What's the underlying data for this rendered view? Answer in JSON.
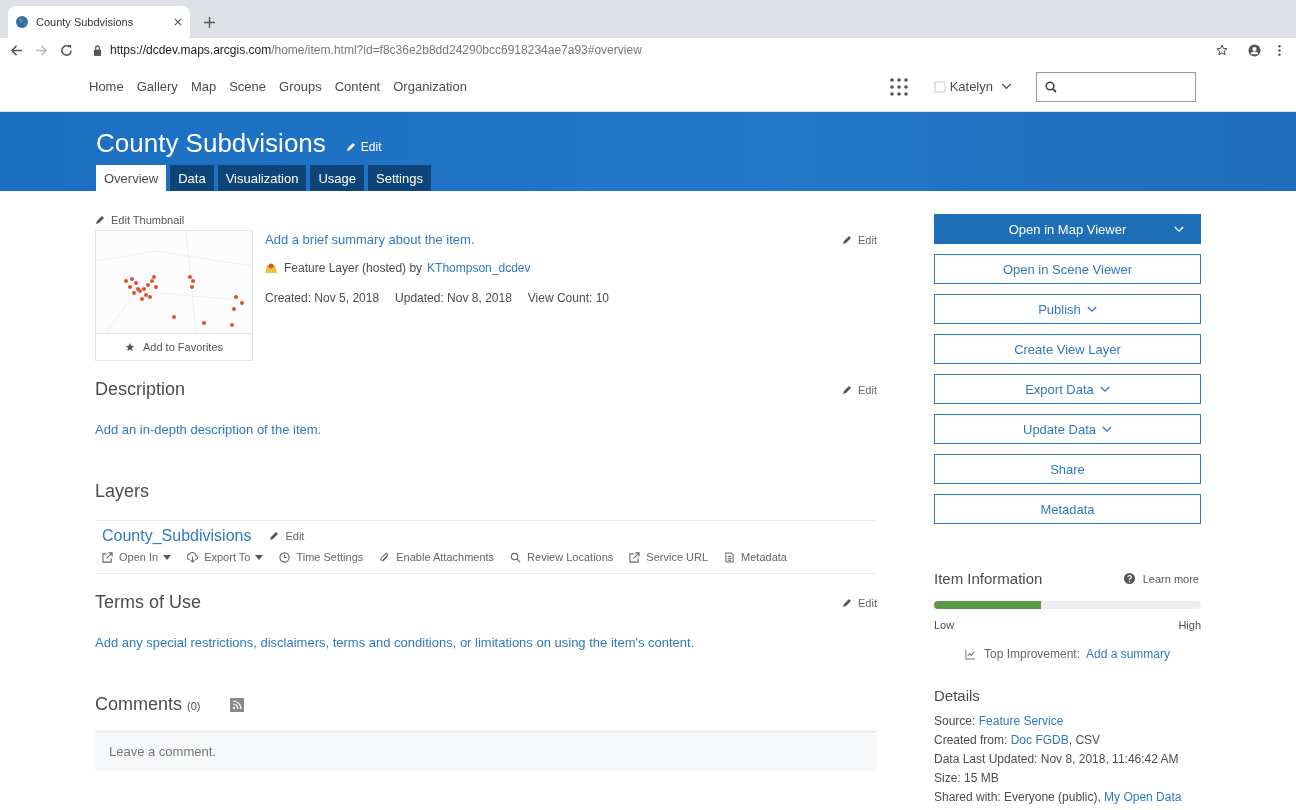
{
  "browser": {
    "tab_title": "County Subdvisions",
    "url_host": "https://dcdev.maps.arcgis.com",
    "url_path": "/home/item.html?id=f8c36e2b8dd24290bcc6918234ae7a93#overview"
  },
  "nav": {
    "items": [
      "Home",
      "Gallery",
      "Map",
      "Scene",
      "Groups",
      "Content",
      "Organization"
    ],
    "user": "Katelyn"
  },
  "header": {
    "title": "County Subdvisions",
    "edit": "Edit"
  },
  "tabs": [
    {
      "label": "Overview",
      "selected": true
    },
    {
      "label": "Data",
      "selected": false
    },
    {
      "label": "Visualization",
      "selected": false
    },
    {
      "label": "Usage",
      "selected": false
    },
    {
      "label": "Settings",
      "selected": false
    }
  ],
  "summary": {
    "edit_thumbnail": "Edit Thumbnail",
    "add_favorites": "Add to Favorites",
    "summary_link": "Add a brief summary about the item.",
    "edit": "Edit",
    "type_text": "Feature Layer (hosted) by",
    "owner": "KThompson_dcdev",
    "created": "Created: Nov 5, 2018",
    "updated": "Updated: Nov 8, 2018",
    "views": "View Count: 10"
  },
  "description": {
    "title": "Description",
    "edit": "Edit",
    "link": "Add an in-depth description of the item."
  },
  "layers": {
    "title": "Layers",
    "layer": {
      "name": "County_Subdivisions",
      "edit": "Edit",
      "actions": [
        {
          "label": "Open In",
          "caret": true
        },
        {
          "label": "Export To",
          "caret": true
        },
        {
          "label": "Time Settings",
          "caret": false
        },
        {
          "label": "Enable Attachments",
          "caret": false
        },
        {
          "label": "Review Locations",
          "caret": false
        },
        {
          "label": "Service URL",
          "caret": false
        },
        {
          "label": "Metadata",
          "caret": false
        }
      ]
    }
  },
  "terms": {
    "title": "Terms of Use",
    "edit": "Edit",
    "link": "Add any special restrictions, disclaimers, terms and conditions, or limitations on using the item's content."
  },
  "comments": {
    "title": "Comments",
    "count": "(0)",
    "field": {
      "placeholder": "Leave a comment."
    }
  },
  "actions": [
    {
      "label": "Open in Map Viewer",
      "kind": "primary",
      "caret": true
    },
    {
      "label": "Open in Scene Viewer",
      "kind": "outline",
      "caret": false
    },
    {
      "label": "Publish",
      "kind": "outline",
      "caret": true
    },
    {
      "label": "Create View Layer",
      "kind": "outline",
      "caret": false
    },
    {
      "label": "Export Data",
      "kind": "outline",
      "caret": true
    },
    {
      "label": "Update Data",
      "kind": "outline",
      "caret": true
    },
    {
      "label": "Share",
      "kind": "outline",
      "caret": false
    },
    {
      "label": "Metadata",
      "kind": "outline",
      "caret": false
    }
  ],
  "item_information": {
    "title": "Item Information",
    "learn_more": "Learn more",
    "level": 0.4,
    "low": "Low",
    "high": "High",
    "improvement_label": "Top Improvement:",
    "improvement_link": "Add a summary"
  },
  "details": {
    "title": "Details",
    "rows": [
      [
        {
          "text": "Source:",
          "link": false
        },
        {
          "text": "Feature Service",
          "link": true
        }
      ],
      [
        {
          "text": "Created from:",
          "link": false
        },
        {
          "text": "Doc FGDB",
          "link": true
        },
        {
          "text": ", CSV",
          "link": false
        }
      ],
      [
        {
          "text": "Data Last Updated: Nov 8, 2018, 11:46:42 AM",
          "link": false
        }
      ],
      [
        {
          "text": "Size: 15 MB",
          "link": false
        }
      ],
      [
        {
          "text": "Shared with: Everyone (public),",
          "link": false
        },
        {
          "text": "My Open Data",
          "link": true
        }
      ]
    ]
  }
}
